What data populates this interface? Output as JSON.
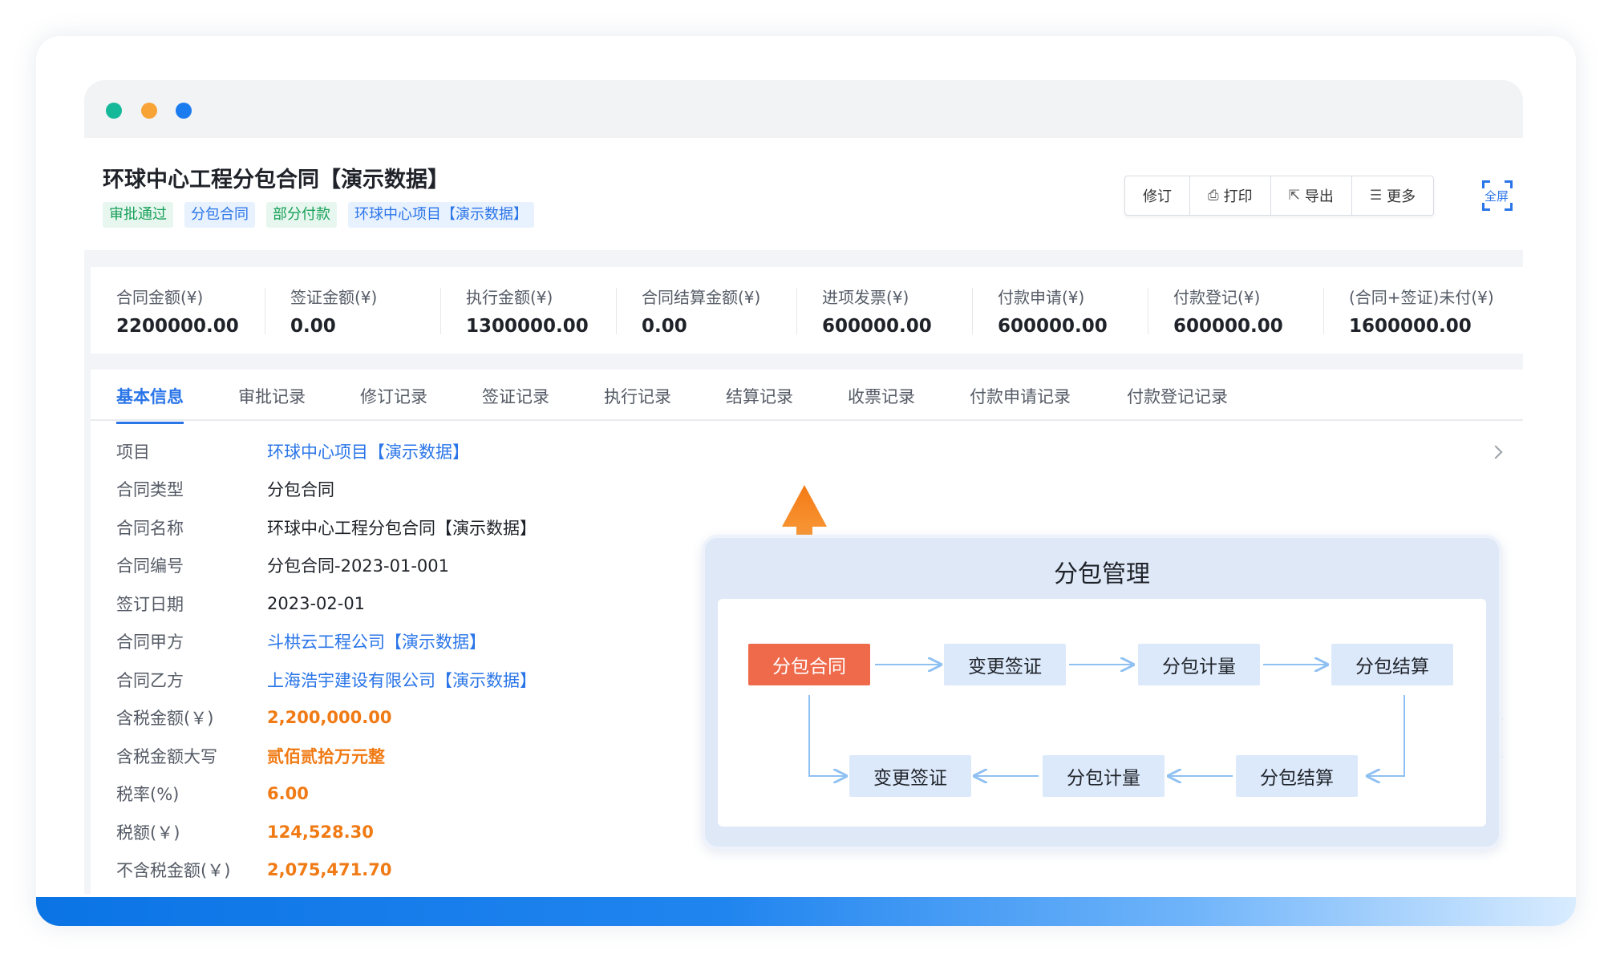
{
  "window": {
    "dots": [
      "#16b89a",
      "#f8a336",
      "#1b7cf0"
    ]
  },
  "header": {
    "title": "环球中心工程分包合同【演示数据】",
    "tags": [
      "审批通过",
      "分包合同",
      "部分付款",
      "环球中心项目【演示数据】"
    ],
    "toolbar": {
      "revise": "修订",
      "print": "打印",
      "export": "导出",
      "more": "更多",
      "fullscreen": "全屏"
    }
  },
  "stats": [
    {
      "label": "合同金额(¥)",
      "value": "2200000.00"
    },
    {
      "label": "签证金额(¥)",
      "value": "0.00"
    },
    {
      "label": "执行金额(¥)",
      "value": "1300000.00"
    },
    {
      "label": "合同结算金额(¥)",
      "value": "0.00"
    },
    {
      "label": "进项发票(¥)",
      "value": "600000.00"
    },
    {
      "label": "付款申请(¥)",
      "value": "600000.00"
    },
    {
      "label": "付款登记(¥)",
      "value": "600000.00"
    },
    {
      "label": "(合同+签证)未付(¥)",
      "value": "1600000.00"
    }
  ],
  "tabs": [
    "基本信息",
    "审批记录",
    "修订记录",
    "签证记录",
    "执行记录",
    "结算记录",
    "收票记录",
    "付款申请记录",
    "付款登记记录"
  ],
  "fields": [
    {
      "label": "项目",
      "value": "环球中心项目【演示数据】"
    },
    {
      "label": "合同类型",
      "value": "分包合同"
    },
    {
      "label": "合同名称",
      "value": "环球中心工程分包合同【演示数据】"
    },
    {
      "label": "合同编号",
      "value": "分包合同-2023-01-001"
    },
    {
      "label": "签订日期",
      "value": "2023-02-01"
    },
    {
      "label": "合同甲方",
      "value": "斗栱云工程公司【演示数据】"
    },
    {
      "label": "合同乙方",
      "value": "上海浩宇建设有限公司【演示数据】"
    },
    {
      "label": "含税金额(￥)",
      "value": "2,200,000.00"
    },
    {
      "label": "含税金额大写",
      "value": "贰佰贰拾万元整"
    },
    {
      "label": "税率(%)",
      "value": "6.00"
    },
    {
      "label": "税额(￥)",
      "value": "124,528.30"
    },
    {
      "label": "不含税金额(￥)",
      "value": "2,075,471.70"
    }
  ],
  "diagram": {
    "title": "分包管理",
    "top_row": [
      "分包合同",
      "变更签证",
      "分包计量",
      "分包结算"
    ],
    "bottom_row": [
      "变更签证",
      "分包计量",
      "分包结算"
    ]
  },
  "colors": {
    "accent": "#2a75e8",
    "money": "#f07a14",
    "start_node": "#ee6a4b",
    "tag_green": "#18a058"
  }
}
